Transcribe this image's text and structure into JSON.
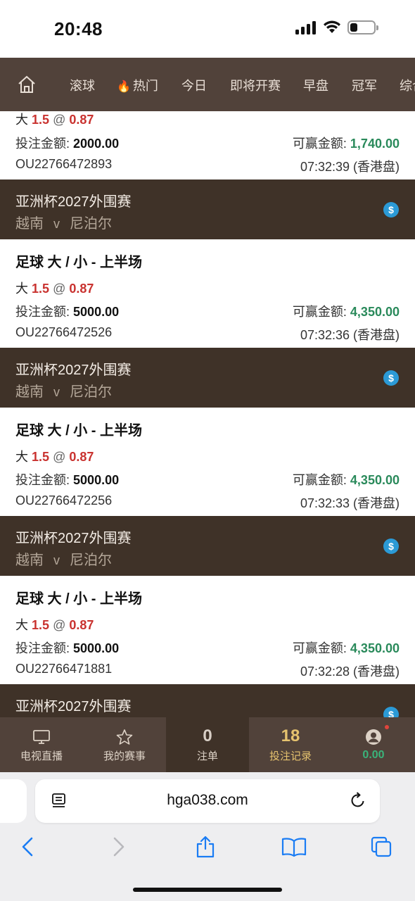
{
  "status_bar": {
    "time": "20:48",
    "battery_level": 0.3
  },
  "nav": {
    "home_icon": "home-icon",
    "items": [
      {
        "label": "滚球"
      },
      {
        "label": "热门",
        "icon": "fire-icon"
      },
      {
        "label": "今日"
      },
      {
        "label": "即将开赛"
      },
      {
        "label": "早盘"
      },
      {
        "label": "冠军"
      },
      {
        "label": "综合"
      }
    ]
  },
  "partial_bet": {
    "pick_side": "大",
    "pick_line": "1.5",
    "at": "@",
    "odds": "0.87",
    "stake_label": "投注金额:",
    "stake": "2000.00",
    "win_label": "可赢金额:",
    "win": "1,740.00",
    "ticket": "OU22766472893",
    "time": "07:32:39 (香港盘)"
  },
  "bets": [
    {
      "league": "亚洲杯2027外围赛",
      "home": "越南",
      "vs": "v",
      "away": "尼泊尔",
      "market": "足球 大 / 小 - 上半场",
      "pick_side": "大",
      "pick_line": "1.5",
      "at": "@",
      "odds": "0.87",
      "stake_label": "投注金额:",
      "stake": "5000.00",
      "win_label": "可赢金额:",
      "win": "4,350.00",
      "ticket": "OU22766472526",
      "time": "07:32:36 (香港盘)"
    },
    {
      "league": "亚洲杯2027外围赛",
      "home": "越南",
      "vs": "v",
      "away": "尼泊尔",
      "market": "足球 大 / 小 - 上半场",
      "pick_side": "大",
      "pick_line": "1.5",
      "at": "@",
      "odds": "0.87",
      "stake_label": "投注金额:",
      "stake": "5000.00",
      "win_label": "可赢金额:",
      "win": "4,350.00",
      "ticket": "OU22766472256",
      "time": "07:32:33 (香港盘)"
    },
    {
      "league": "亚洲杯2027外围赛",
      "home": "越南",
      "vs": "v",
      "away": "尼泊尔",
      "market": "足球 大 / 小 - 上半场",
      "pick_side": "大",
      "pick_line": "1.5",
      "at": "@",
      "odds": "0.87",
      "stake_label": "投注金额:",
      "stake": "5000.00",
      "win_label": "可赢金额:",
      "win": "4,350.00",
      "ticket": "OU22766471881",
      "time": "07:32:28 (香港盘)"
    }
  ],
  "partial_header": {
    "league": "亚洲杯2027外围赛"
  },
  "tab_bar": {
    "live_tv": "电视直播",
    "my_events": "我的赛事",
    "slip_count": "0",
    "slip_label": "注单",
    "records_count": "18",
    "records_label": "投注记录",
    "balance": "0.00"
  },
  "browser": {
    "url": "hga038.com"
  },
  "colors": {
    "nav_bg": "#51423a",
    "header_bg": "#3f3228",
    "odds_red": "#c9322f",
    "win_green": "#2a8a5b",
    "accent_gold": "#e6c36f"
  }
}
